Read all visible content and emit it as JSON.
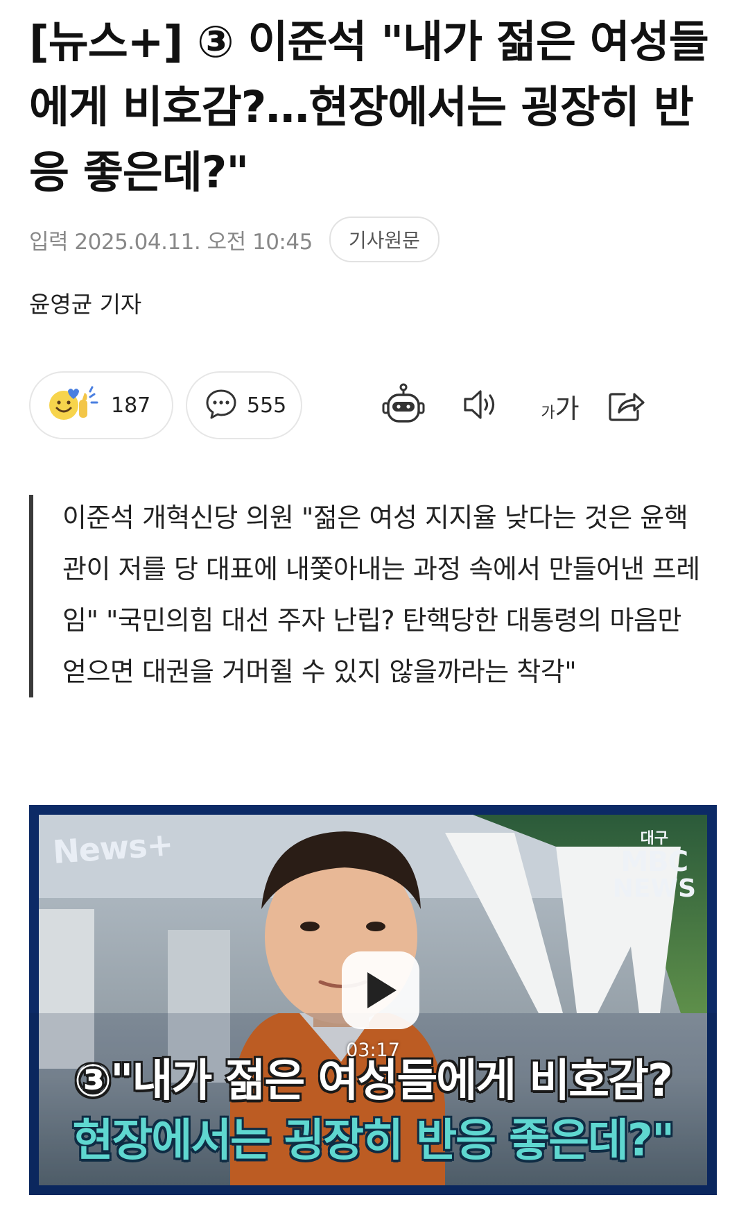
{
  "article": {
    "headline": "[뉴스+] ③ 이준석 \"내가 젊은 여성들에게 비호감?…현장에서는 굉장히 반응 좋은데?\"",
    "date_label": "입력 2025.04.11. 오전 10:45",
    "original_button": "기사원문",
    "reporter": "윤영균 기자"
  },
  "actions": {
    "reaction_count": "187",
    "comment_count": "555",
    "font_size_label_small": "가",
    "font_size_label_large": "가",
    "icons": [
      "reaction-emoji-icon",
      "comment-bubble-icon",
      "ai-summary-robot-icon",
      "speaker-icon",
      "font-size-icon",
      "share-icon"
    ]
  },
  "summary_quote": "이준석 개혁신당 의원 \"젊은 여성 지지율 낮다는 것은 윤핵관이 저를 당 대표에 내쫓아내는 과정 속에서 만들어낸 프레임\" \"국민의힘 대선 주자 난립? 탄핵당한 대통령의 마음만 얻으면 대권을 거머쥘 수 있지 않을까라는 착각\"",
  "video": {
    "badge": "News+",
    "channel_region": "대구",
    "channel_logo": "MBC",
    "channel_news": "NEWS",
    "caption_line1": "③\"내가 젊은 여성들에게 비호감?",
    "caption_line2": "현장에서는 굉장히 반응 좋은데?\"",
    "duration": "03:17",
    "colors": {
      "frame": "#0c2a66",
      "caption_teal": "#5fd7d0"
    }
  }
}
